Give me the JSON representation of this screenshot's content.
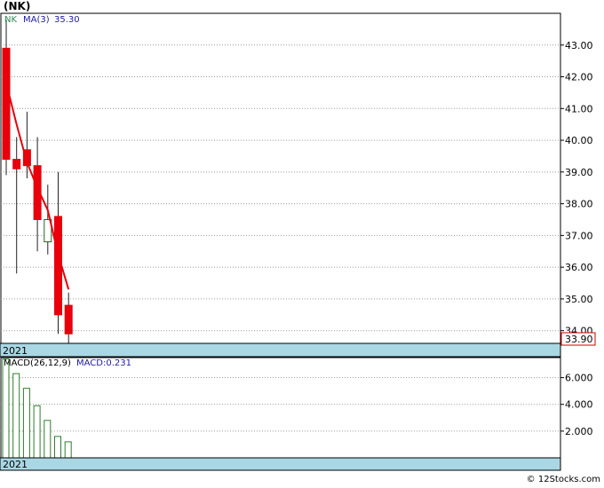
{
  "title": "(NK)",
  "watermark": "© 12Stocks.com",
  "colors": {
    "down": "#e8000b",
    "up_fill": "#ffffff",
    "up_stroke": "#1f6a1f",
    "ma": "#e8000b",
    "year_band": "#a9d7e3",
    "price_tag_border": "#cc0000",
    "macd_bar": "#2e7d2e",
    "legend_symbol": "#2e8b57",
    "legend_text": "#1c1ca8",
    "grid": "#9a9a9a"
  },
  "price_panel": {
    "legend_symbol": "NK",
    "legend_ma_label": "MA(3)",
    "legend_ma_value": "35.30",
    "last_price_tag": "33.90",
    "year_label": "2021"
  },
  "macd_panel": {
    "legend_label": "MACD(26,12,9)",
    "legend_value": "MACD:0.231",
    "year_label": "2021"
  },
  "chart_data": [
    {
      "type": "candlestick",
      "ylim": [
        33.6,
        44.0
      ],
      "yticks": [
        34.0,
        35.0,
        36.0,
        37.0,
        38.0,
        39.0,
        40.0,
        41.0,
        42.0,
        43.0
      ],
      "ytick_labels": [
        "34.00",
        "35.00",
        "36.00",
        "37.00",
        "38.00",
        "39.00",
        "40.00",
        "41.00",
        "42.00",
        "43.00"
      ],
      "grid": true,
      "candles": [
        {
          "open": 42.9,
          "high": 43.8,
          "low": 38.9,
          "close": 39.4
        },
        {
          "open": 39.4,
          "high": 40.1,
          "low": 35.8,
          "close": 39.1
        },
        {
          "open": 39.7,
          "high": 40.9,
          "low": 38.8,
          "close": 39.2
        },
        {
          "open": 39.2,
          "high": 40.1,
          "low": 36.5,
          "close": 37.5
        },
        {
          "open": 36.8,
          "high": 38.6,
          "low": 36.4,
          "close": 37.5
        },
        {
          "open": 37.6,
          "high": 39.0,
          "low": 33.9,
          "close": 34.5
        },
        {
          "open": 34.8,
          "high": 35.2,
          "low": 33.6,
          "close": 33.9
        }
      ],
      "ma_series": {
        "name": "MA(3)",
        "points": [
          {
            "i": 0,
            "v": 41.8
          },
          {
            "i": 1,
            "v": 40.5
          },
          {
            "i": 2,
            "v": 39.3
          },
          {
            "i": 3,
            "v": 38.5
          },
          {
            "i": 4,
            "v": 37.8
          },
          {
            "i": 5,
            "v": 36.4
          },
          {
            "i": 6,
            "v": 35.3
          }
        ]
      }
    },
    {
      "type": "bar",
      "ylim": [
        0,
        7.5
      ],
      "yticks": [
        2.0,
        4.0,
        6.0
      ],
      "ytick_labels": [
        "2.000",
        "4.000",
        "6.000"
      ],
      "grid": true,
      "values": [
        7.4,
        6.3,
        5.2,
        3.9,
        2.8,
        1.6,
        1.2
      ]
    }
  ]
}
